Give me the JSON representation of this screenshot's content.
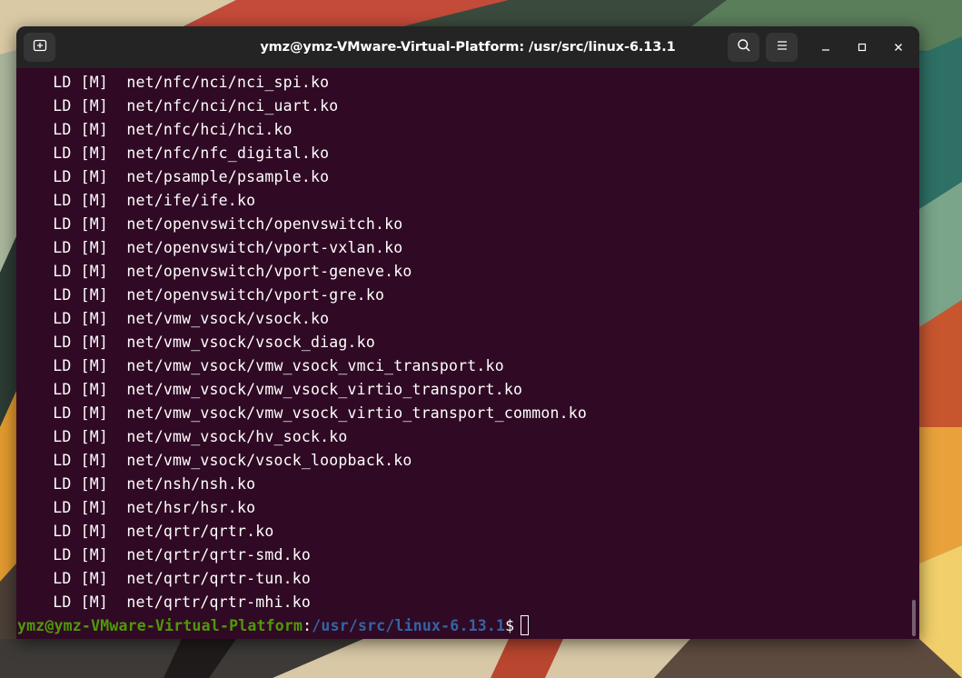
{
  "window": {
    "title": "ymz@ymz-VMware-Virtual-Platform: /usr/src/linux-6.13.1"
  },
  "titlebar": {
    "new_tab_icon": "new-tab-icon",
    "search_icon": "search-icon",
    "menu_icon": "hamburger-menu-icon",
    "minimize_icon": "minimize-icon",
    "maximize_icon": "maximize-icon",
    "close_icon": "close-icon"
  },
  "terminal": {
    "lines": [
      "  LD [M]  net/nfc/nci/nci_spi.ko",
      "  LD [M]  net/nfc/nci/nci_uart.ko",
      "  LD [M]  net/nfc/hci/hci.ko",
      "  LD [M]  net/nfc/nfc_digital.ko",
      "  LD [M]  net/psample/psample.ko",
      "  LD [M]  net/ife/ife.ko",
      "  LD [M]  net/openvswitch/openvswitch.ko",
      "  LD [M]  net/openvswitch/vport-vxlan.ko",
      "  LD [M]  net/openvswitch/vport-geneve.ko",
      "  LD [M]  net/openvswitch/vport-gre.ko",
      "  LD [M]  net/vmw_vsock/vsock.ko",
      "  LD [M]  net/vmw_vsock/vsock_diag.ko",
      "  LD [M]  net/vmw_vsock/vmw_vsock_vmci_transport.ko",
      "  LD [M]  net/vmw_vsock/vmw_vsock_virtio_transport.ko",
      "  LD [M]  net/vmw_vsock/vmw_vsock_virtio_transport_common.ko",
      "  LD [M]  net/vmw_vsock/hv_sock.ko",
      "  LD [M]  net/vmw_vsock/vsock_loopback.ko",
      "  LD [M]  net/nsh/nsh.ko",
      "  LD [M]  net/hsr/hsr.ko",
      "  LD [M]  net/qrtr/qrtr.ko",
      "  LD [M]  net/qrtr/qrtr-smd.ko",
      "  LD [M]  net/qrtr/qrtr-tun.ko",
      "  LD [M]  net/qrtr/qrtr-mhi.ko"
    ],
    "prompt": {
      "user_host": "ymz@ymz-VMware-Virtual-Platform",
      "colon": ":",
      "path": "/usr/src/linux-6.13.1",
      "symbol": "$"
    }
  },
  "colors": {
    "terminal_bg": "#300a24",
    "titlebar_bg": "#242424",
    "prompt_user": "#4e9a06",
    "prompt_path": "#3465a4"
  }
}
